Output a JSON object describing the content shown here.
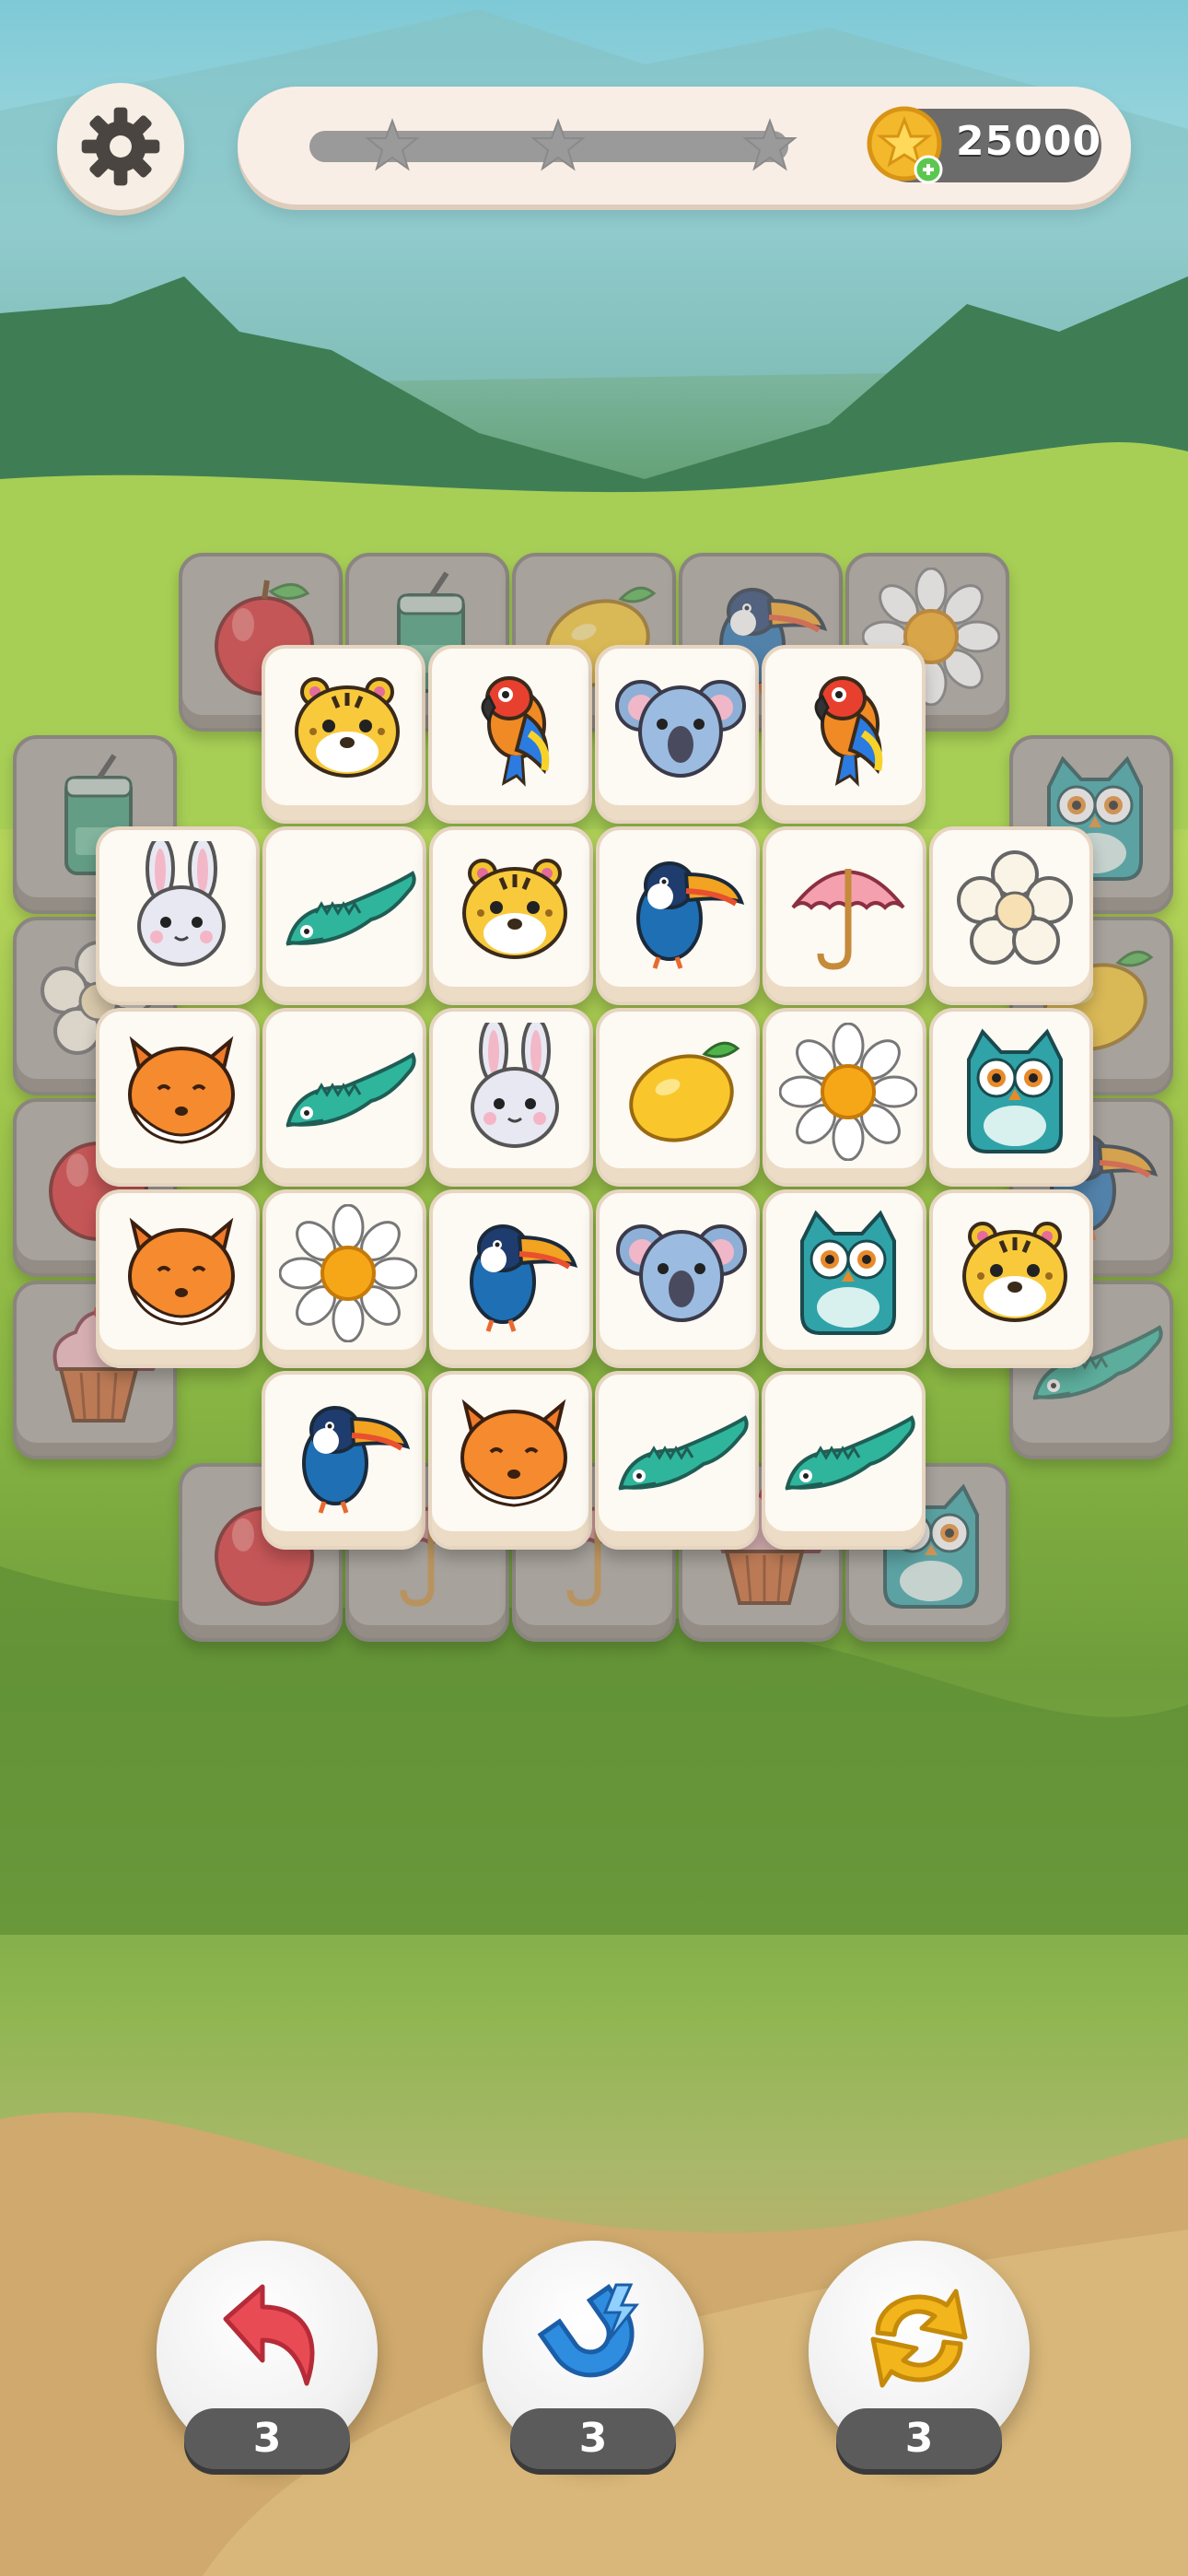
{
  "hud": {
    "settings_icon": "gear-icon",
    "progress_fraction": 0.0,
    "progress_stars": 3,
    "coins": "25000"
  },
  "board": {
    "layer0_tiles": [
      "apple",
      "soda-can",
      "lemon",
      "toucan",
      "daisy",
      "soda-can",
      "owl",
      "flower",
      "lemon",
      "apple",
      "toucan",
      "cupcake",
      "crocodile",
      "apple",
      "umbrella",
      "umbrella",
      "cupcake",
      "owl"
    ],
    "layer1_rows": [
      [
        "tiger",
        "parrot",
        "koala",
        "parrot"
      ],
      [
        "bunny",
        "crocodile",
        "tiger",
        "toucan",
        "umbrella",
        "flower"
      ],
      [
        "fox",
        "crocodile",
        "bunny",
        "lemon",
        "daisy",
        "owl"
      ],
      [
        "fox",
        "daisy",
        "toucan",
        "koala",
        "owl",
        "tiger"
      ],
      [
        "toucan",
        "fox",
        "crocodile",
        "crocodile"
      ]
    ]
  },
  "powerups": [
    {
      "name": "undo",
      "icon": "undo-arrow-icon",
      "count": "3",
      "color": "#e94b55"
    },
    {
      "name": "magnet",
      "icon": "magnet-icon",
      "count": "3",
      "color": "#2f8de0"
    },
    {
      "name": "shuffle",
      "icon": "shuffle-icon",
      "count": "3",
      "color": "#f2b51b"
    }
  ],
  "colors": {
    "tile_face": "#fdf9f3",
    "tile_back": "#a7a29c",
    "coin_gold": "#f3b82c"
  }
}
